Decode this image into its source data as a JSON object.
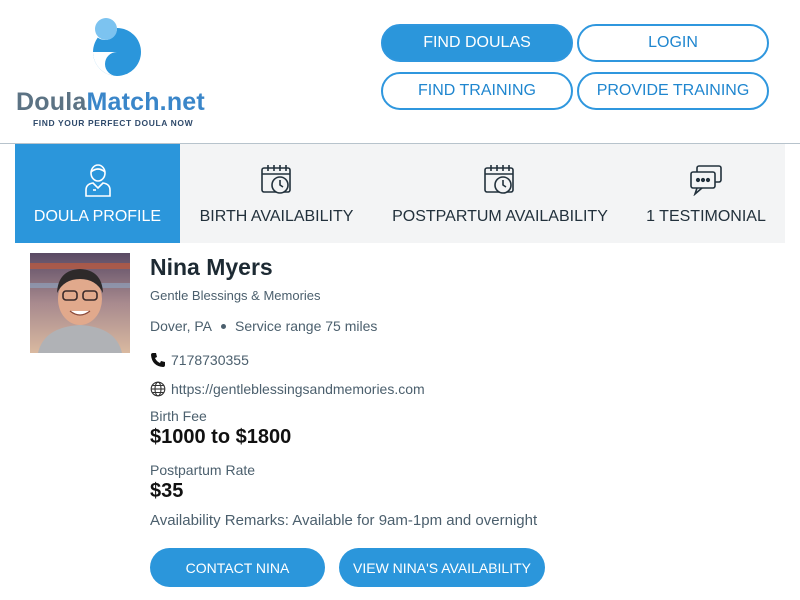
{
  "brand": {
    "name_part1": "Doula",
    "name_part2": "Match.net",
    "tagline": "FIND YOUR PERFECT DOULA NOW",
    "colors": {
      "primary": "#2b96db",
      "gray": "#5c7384"
    }
  },
  "nav": {
    "find_doulas": "FIND DOULAS",
    "login": "LOGIN",
    "find_training": "FIND TRAINING",
    "provide_training": "PROVIDE TRAINING"
  },
  "tabs": [
    {
      "label": "DOULA PROFILE",
      "icon": "doula-person-icon",
      "active": true
    },
    {
      "label": "BIRTH AVAILABILITY",
      "icon": "calendar-clock-icon",
      "active": false
    },
    {
      "label": "POSTPARTUM AVAILABILITY",
      "icon": "calendar-clock-icon",
      "active": false
    },
    {
      "label": "1 TESTIMONIAL",
      "icon": "chat-bubbles-icon",
      "active": false
    }
  ],
  "profile": {
    "name": "Nina Myers",
    "business": "Gentle Blessings & Memories",
    "location": "Dover, PA",
    "service_range": "Service range 75 miles",
    "phone": "7178730355",
    "website": "https://gentleblessingsandmemories.com",
    "birth_fee_label": "Birth Fee",
    "birth_fee": "$1000 to $1800",
    "postpartum_label": "Postpartum Rate",
    "postpartum_rate": "$35",
    "remarks": "Availability Remarks: Available for 9am-1pm and overnight"
  },
  "actions": {
    "contact": "CONTACT NINA",
    "availability": "VIEW NINA'S AVAILABILITY"
  }
}
